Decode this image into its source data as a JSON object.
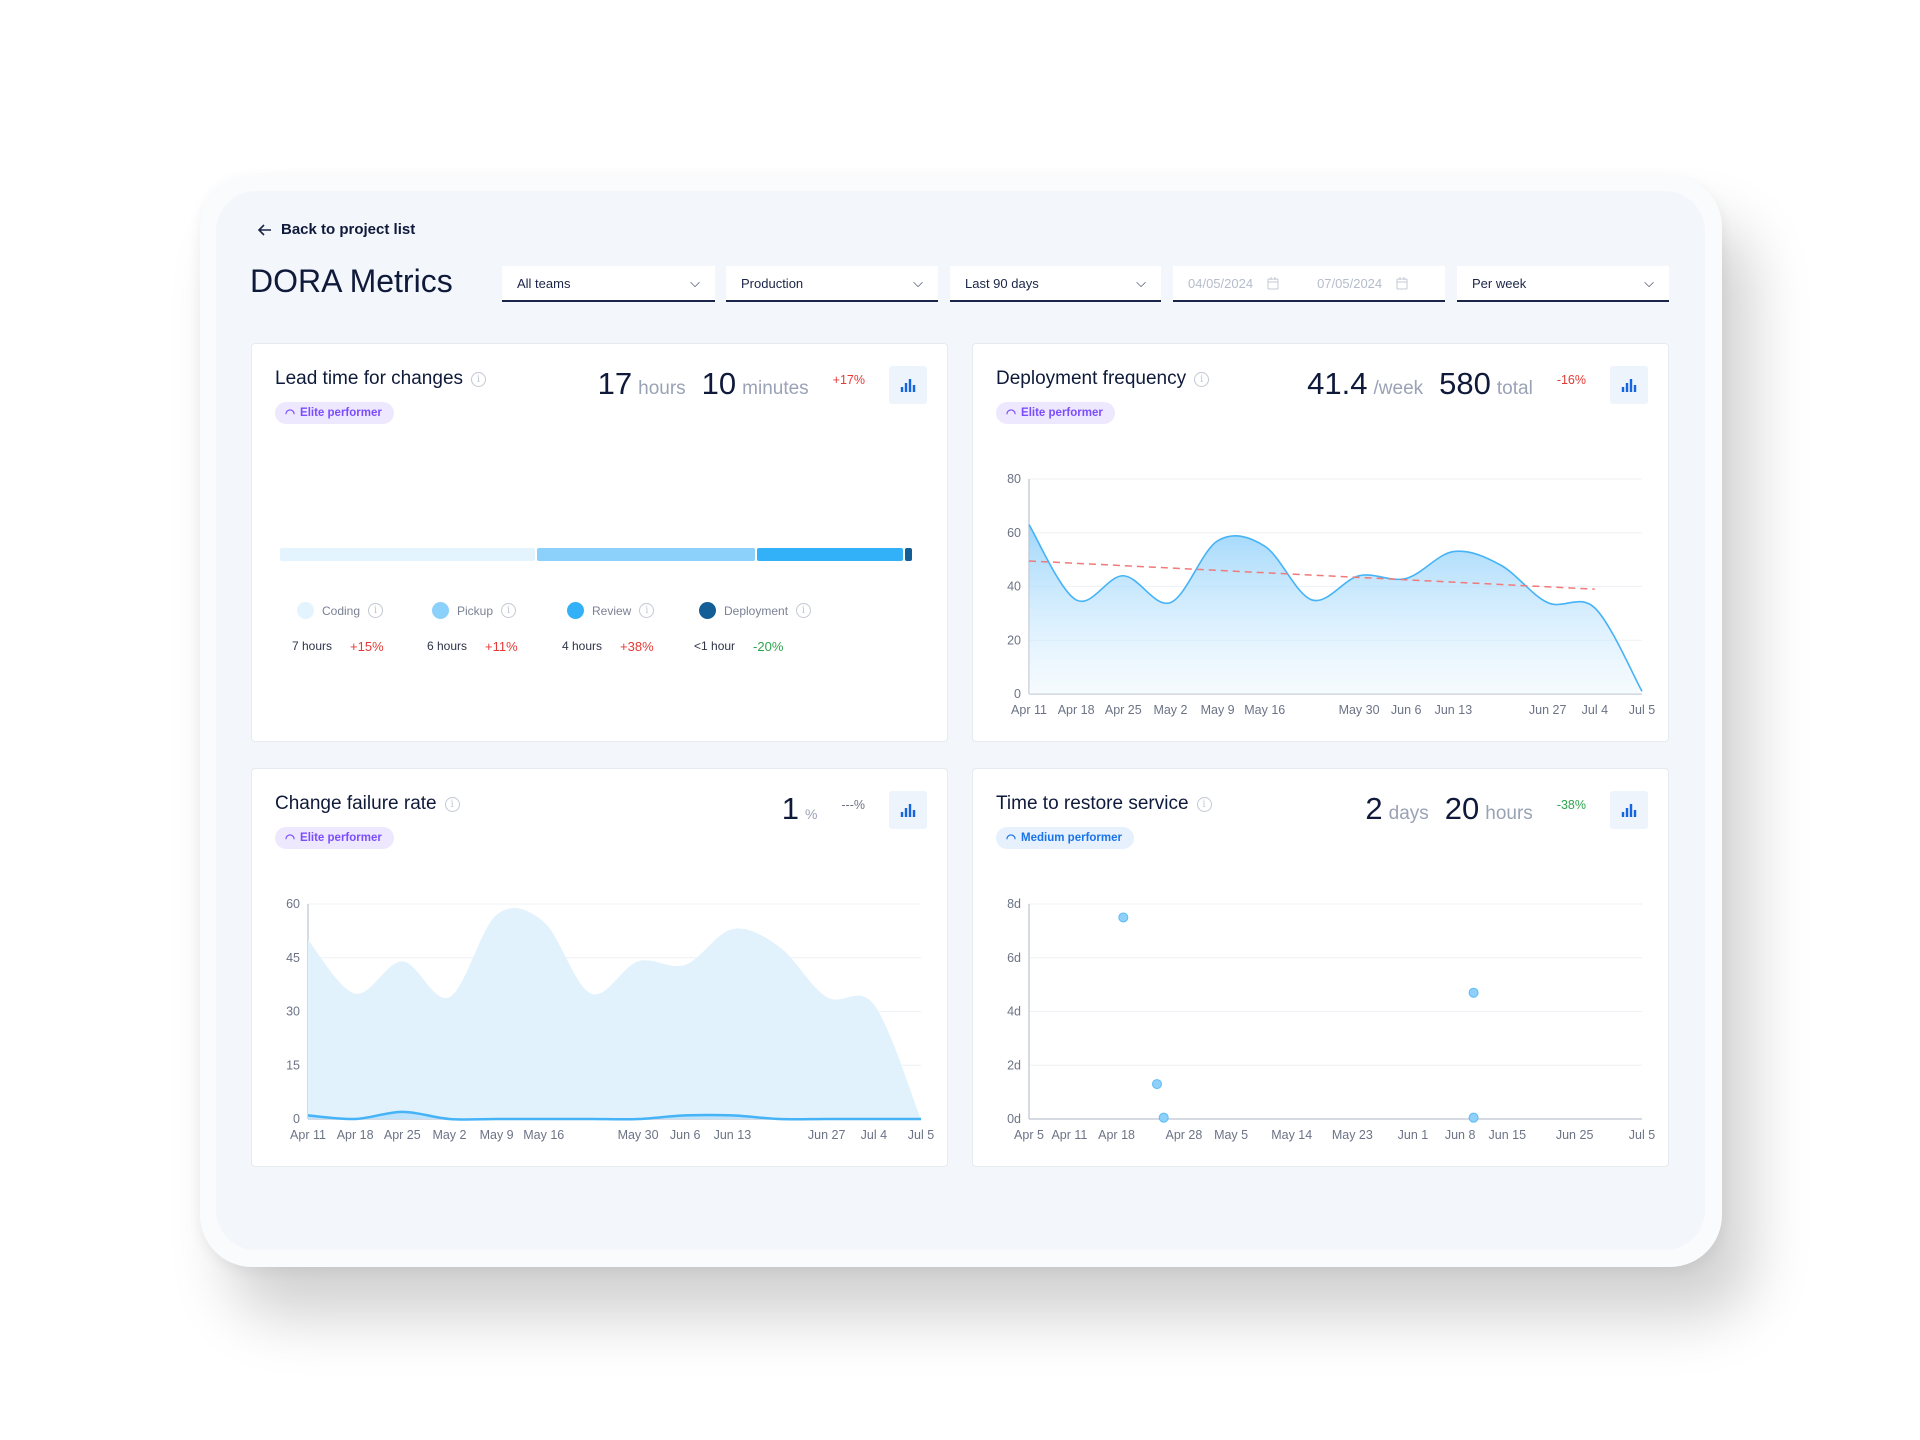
{
  "nav": {
    "back_label": "Back to project list"
  },
  "page_title": "DORA Metrics",
  "filters": {
    "team": "All teams",
    "environment": "Production",
    "range": "Last 90 days",
    "date_from_placeholder": "04/05/2024",
    "date_to_placeholder": "07/05/2024",
    "granularity": "Per week"
  },
  "colors": {
    "accent": "#1565e0",
    "red": "#e53935",
    "green": "#2ea44f",
    "elite": "#7c4dff",
    "medium": "#1a73e8",
    "area": "#5bbcf7"
  },
  "lead_time": {
    "title": "Lead time for changes",
    "badge": "Elite performer",
    "value1": "17",
    "unit1": "hours",
    "value2": "10",
    "unit2": "minutes",
    "delta": "+17%",
    "stages": [
      {
        "name": "Coding",
        "value": "7 hours",
        "delta": "+15%",
        "hours": 7,
        "color": "#e3f4fe",
        "trend": "red"
      },
      {
        "name": "Pickup",
        "value": "6 hours",
        "delta": "+11%",
        "hours": 6,
        "color": "#8cd1fb",
        "trend": "red"
      },
      {
        "name": "Review",
        "value": "4 hours",
        "delta": "+38%",
        "hours": 4,
        "color": "#33b1f8",
        "trend": "red"
      },
      {
        "name": "Deployment",
        "value": "<1 hour",
        "delta": "-20%",
        "hours": 0.2,
        "color": "#135e96",
        "trend": "green"
      }
    ]
  },
  "deploy_freq": {
    "title": "Deployment frequency",
    "badge": "Elite performer",
    "value1": "41.4",
    "unit1": "/week",
    "value2": "580",
    "unit2": "total",
    "delta": "-16%"
  },
  "change_failure": {
    "title": "Change failure rate",
    "badge": "Elite performer",
    "value1": "1",
    "unit1": "%",
    "delta": "---%"
  },
  "restore": {
    "title": "Time to restore service",
    "badge": "Medium performer",
    "value1": "2",
    "unit1": "days",
    "value2": "20",
    "unit2": "hours",
    "delta": "-38%"
  },
  "chart_data": [
    {
      "id": "deploy_freq",
      "type": "area",
      "ylim": [
        0,
        80
      ],
      "yticks": [
        0,
        20,
        40,
        60,
        80
      ],
      "grid": true,
      "categories": [
        "Apr 11",
        "Apr 18",
        "Apr 25",
        "May 2",
        "May 9",
        "May 16",
        "",
        "May 30",
        "Jun 6",
        "Jun 13",
        "",
        "Jun 27",
        "Jul 4",
        "Jul 5"
      ],
      "series": [
        {
          "values": [
            63,
            35,
            44,
            34,
            57,
            55,
            35,
            44,
            43,
            53,
            48,
            34,
            32,
            1
          ]
        }
      ],
      "trendline": {
        "start": 49.5,
        "end": 39,
        "color": "#f07a7a"
      }
    },
    {
      "id": "change_failure",
      "type": "area",
      "ylim": [
        0,
        60
      ],
      "yticks": [
        0,
        15,
        30,
        45,
        60
      ],
      "grid": true,
      "categories": [
        "Apr 11",
        "Apr 18",
        "Apr 25",
        "May 2",
        "May 9",
        "May 16",
        "",
        "May 30",
        "Jun 6",
        "Jun 13",
        "",
        "Jun 27",
        "Jul 4",
        "Jul 5"
      ],
      "series": [
        {
          "values": [
            50,
            35,
            44,
            34,
            57,
            55,
            35,
            44,
            43,
            53,
            48,
            34,
            32,
            0
          ]
        },
        {
          "values": [
            1,
            0,
            2,
            0,
            0,
            0,
            0,
            0,
            1,
            1,
            0,
            0,
            0,
            0
          ]
        }
      ]
    },
    {
      "id": "restore",
      "type": "scatter",
      "ylim": [
        0,
        8
      ],
      "yticks": [
        "0d",
        "2d",
        "4d",
        "6d",
        "8d"
      ],
      "grid": true,
      "xlim": [
        "2024-04-05",
        "2024-07-05"
      ],
      "xticks": [
        [
          "Apr 5",
          "2024-04-05"
        ],
        [
          "Apr 11",
          "2024-04-11"
        ],
        [
          "Apr 18",
          "2024-04-18"
        ],
        [
          "Apr 28",
          "2024-04-28"
        ],
        [
          "May 5",
          "2024-05-05"
        ],
        [
          "May 14",
          "2024-05-14"
        ],
        [
          "May 23",
          "2024-05-23"
        ],
        [
          "Jun 1",
          "2024-06-01"
        ],
        [
          "Jun 8",
          "2024-06-08"
        ],
        [
          "Jun 15",
          "2024-06-15"
        ],
        [
          "Jun 25",
          "2024-06-25"
        ],
        [
          "Jul 5",
          "2024-07-05"
        ]
      ],
      "points": [
        [
          "2024-04-19",
          7.5
        ],
        [
          "2024-04-24",
          1.3
        ],
        [
          "2024-04-25",
          0.05
        ],
        [
          "2024-06-10",
          4.7
        ],
        [
          "2024-06-10",
          0.05
        ]
      ]
    }
  ]
}
